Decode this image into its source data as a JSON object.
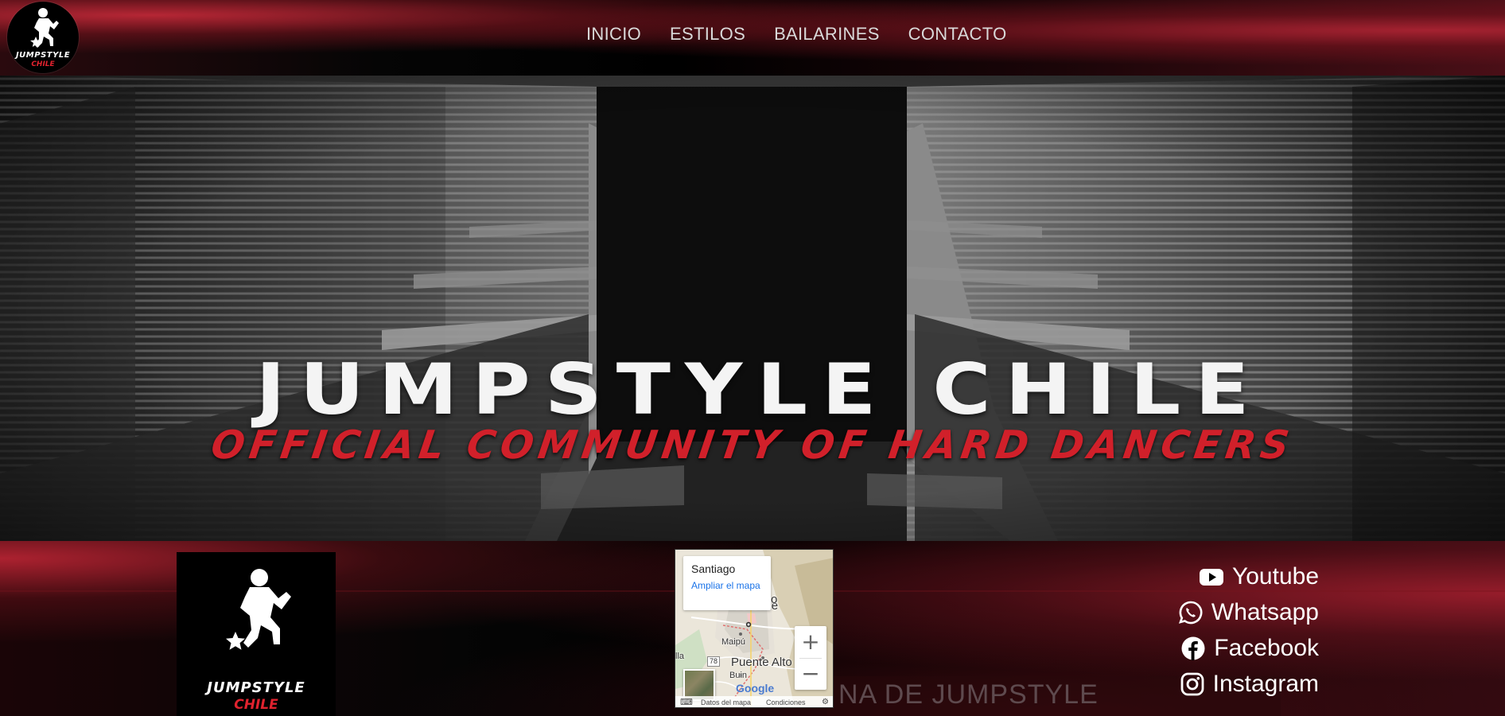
{
  "header": {
    "logo": {
      "line1": "JUMPSTYLE",
      "line2": "CHILE"
    },
    "nav": [
      {
        "label": "INICIO"
      },
      {
        "label": "ESTILOS"
      },
      {
        "label": "BAILARINES"
      },
      {
        "label": "CONTACTO"
      }
    ]
  },
  "hero": {
    "title": "JUMPSTYLE CHILE",
    "subtitle": "OFFICIAL COMMUNITY OF HARD DANCERS"
  },
  "footer": {
    "logo": {
      "line1": "JUMPSTYLE",
      "line2": "CHILE"
    },
    "faded_heading": "NA DE JUMPSTYLE",
    "map": {
      "place_name": "Santiago",
      "expand_link": "Ampliar el mapa",
      "labels": {
        "city": "de Chile",
        "city_prefix": "o",
        "maipu": "Maipú",
        "puente_alto": "Puente Alto",
        "buin": "Buin",
        "lla": "lla",
        "route": "78"
      },
      "zoom_in": "+",
      "zoom_out": "−",
      "google": "Google",
      "attribution": {
        "keyboard": "⌨",
        "data": "Datos del mapa",
        "terms": "Condiciones",
        "settings": "⚙"
      }
    },
    "social": [
      {
        "label": "Youtube",
        "icon": "youtube-icon"
      },
      {
        "label": "Whatsapp",
        "icon": "whatsapp-icon"
      },
      {
        "label": "Facebook",
        "icon": "facebook-icon"
      },
      {
        "label": "Instagram",
        "icon": "instagram-icon"
      }
    ]
  },
  "colors": {
    "accent_red": "#d1202a",
    "nav_text": "#d9d9d9",
    "link_blue": "#1a73e8"
  }
}
